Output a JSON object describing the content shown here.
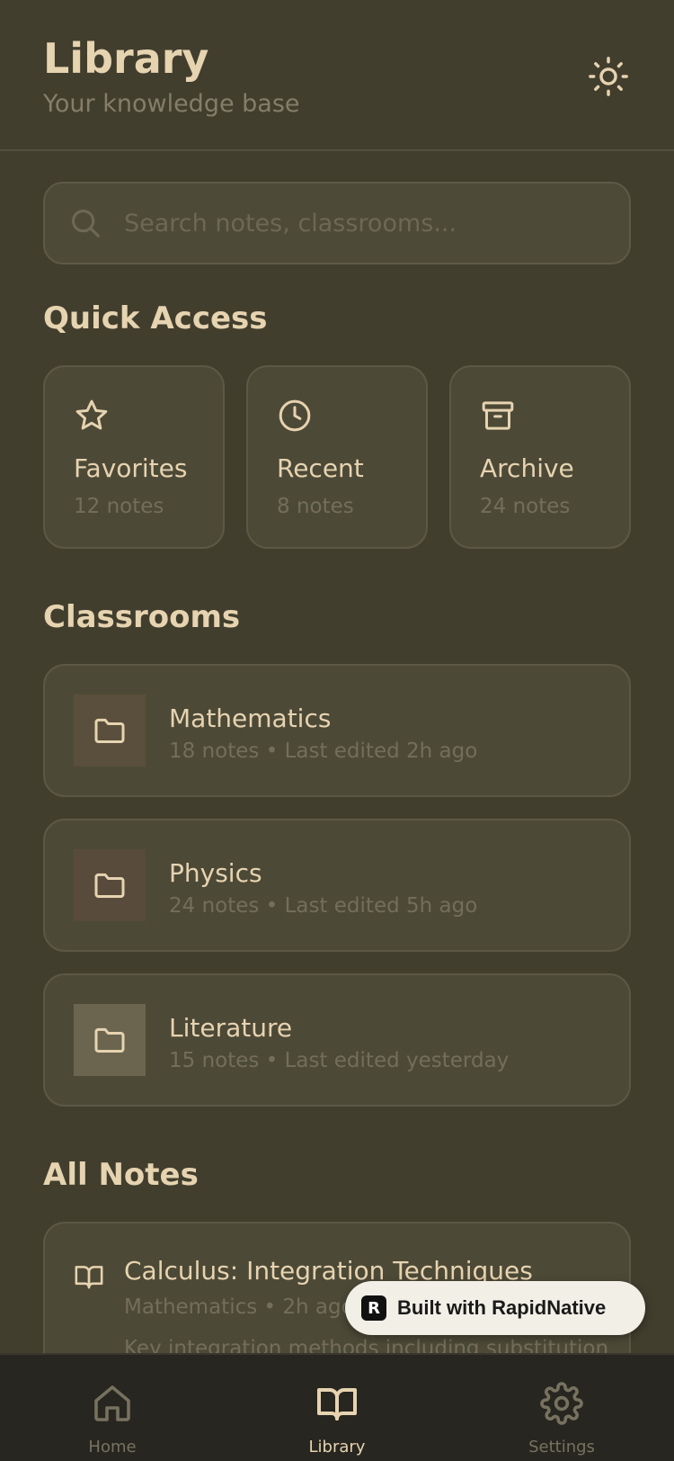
{
  "header": {
    "title": "Library",
    "subtitle": "Your knowledge base",
    "theme_icon": "sun-icon"
  },
  "search": {
    "placeholder": "Search notes, classrooms...",
    "value": ""
  },
  "quick_access": {
    "title": "Quick Access",
    "items": [
      {
        "label": "Favorites",
        "count": "12 notes",
        "icon": "star-icon"
      },
      {
        "label": "Recent",
        "count": "8 notes",
        "icon": "clock-icon"
      },
      {
        "label": "Archive",
        "count": "24 notes",
        "icon": "archive-icon"
      }
    ]
  },
  "classrooms": {
    "title": "Classrooms",
    "items": [
      {
        "name": "Mathematics",
        "meta": "18 notes • Last edited 2h ago",
        "color": "#5a4f3c"
      },
      {
        "name": "Physics",
        "meta": "24 notes • Last edited 5h ago",
        "color": "#584b3c"
      },
      {
        "name": "Literature",
        "meta": "15 notes • Last edited yesterday",
        "color": "#6b654f"
      }
    ]
  },
  "all_notes": {
    "title": "All Notes",
    "items": [
      {
        "title": "Calculus: Integration Techniques",
        "meta": "Mathematics • 2h ago",
        "snippet": "Key integration methods including substitution"
      }
    ]
  },
  "badge": {
    "text": "Built with RapidNative"
  },
  "tabs": [
    {
      "label": "Home",
      "icon": "home-icon"
    },
    {
      "label": "Library",
      "icon": "book-icon",
      "active": true
    },
    {
      "label": "Settings",
      "icon": "gear-icon"
    }
  ],
  "colors": {
    "background": "#423e2e",
    "card": "#4d4937",
    "accent": "#e6d3b0",
    "muted": "#736e59",
    "tabbar": "#282620"
  }
}
